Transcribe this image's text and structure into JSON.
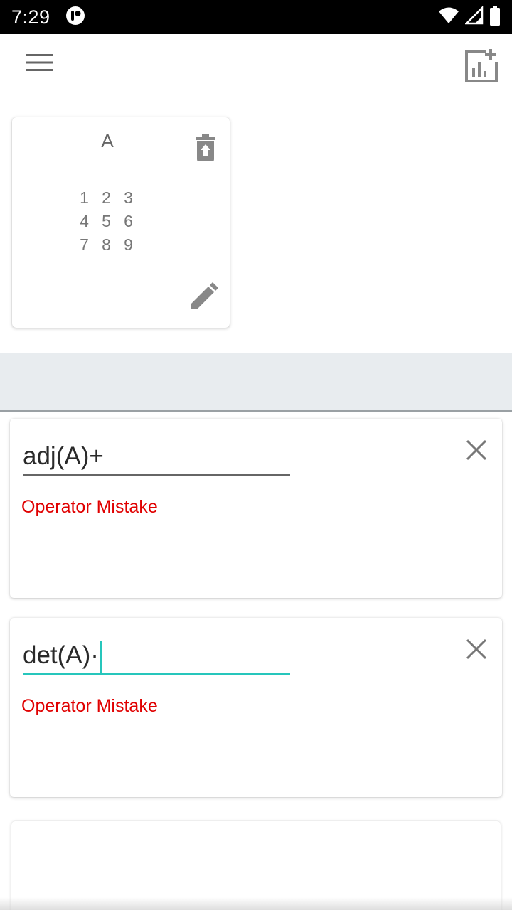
{
  "status": {
    "time": "7:29",
    "icons": [
      "app-notification-icon",
      "wifi-icon",
      "cell-signal-icon",
      "battery-icon"
    ]
  },
  "app_bar": {
    "menu_icon": "hamburger-menu-icon",
    "action_icon": "add-chart-icon"
  },
  "matrix": {
    "name": "A",
    "rows": [
      [
        "1",
        "2",
        "3"
      ],
      [
        "4",
        "5",
        "6"
      ],
      [
        "7",
        "8",
        "9"
      ]
    ],
    "delete_icon": "delete-icon",
    "edit_icon": "edit-pencil-icon"
  },
  "expressions": [
    {
      "value": "adj(A)+",
      "error": "Operator Mistake",
      "focused": false
    },
    {
      "value": "det(A)·",
      "error": "Operator Mistake",
      "focused": true
    }
  ],
  "colors": {
    "accent": "#26c6bc",
    "error": "#e00000",
    "icon": "#757575",
    "band": "#e8ecef"
  }
}
